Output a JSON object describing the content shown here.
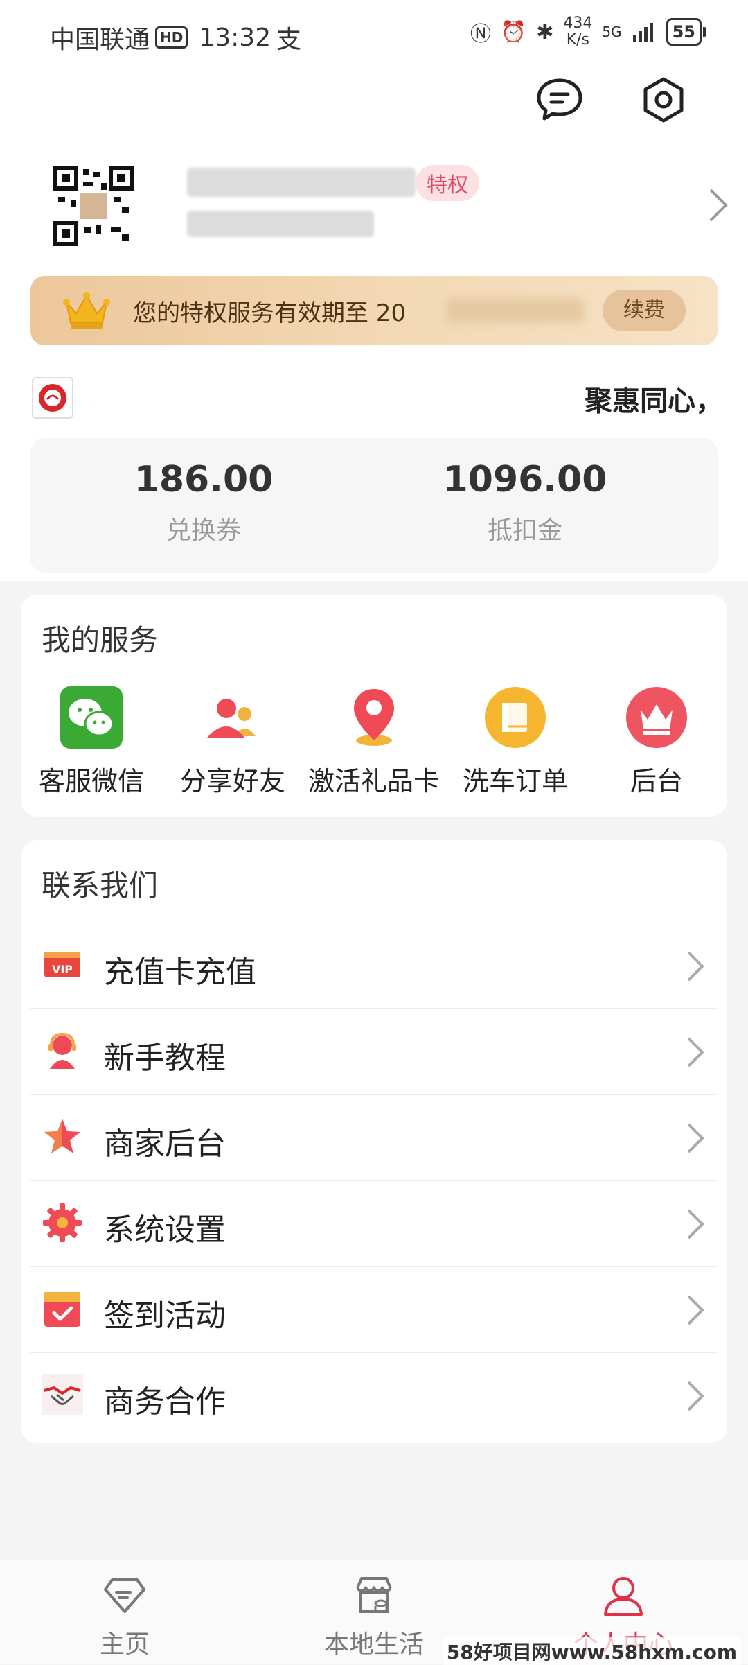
{
  "status_bar": {
    "carrier": "中国联通",
    "hd": "HD",
    "time": "13:32",
    "extra": "支",
    "speed_value": "434",
    "speed_unit": "K/s",
    "network": "5G",
    "battery": "55"
  },
  "profile": {
    "vip_tag": "特权"
  },
  "privilege": {
    "text": "您的特权服务有效期至 20",
    "renew_label": "续费"
  },
  "slogan": "聚惠同心，",
  "balance": [
    {
      "value": "186.00",
      "label": "兑换券"
    },
    {
      "value": "1096.00",
      "label": "抵扣金"
    }
  ],
  "services": {
    "title": "我的服务",
    "items": [
      {
        "label": "客服微信",
        "icon": "wechat-icon"
      },
      {
        "label": "分享好友",
        "icon": "users-icon"
      },
      {
        "label": "激活礼品卡",
        "icon": "location-pin-icon"
      },
      {
        "label": "洗车订单",
        "icon": "book-icon"
      },
      {
        "label": "后台",
        "icon": "crown-icon"
      }
    ]
  },
  "contact": {
    "title": "联系我们",
    "items": [
      {
        "label": "充值卡充值",
        "icon": "vip-card-icon"
      },
      {
        "label": "新手教程",
        "icon": "support-agent-icon"
      },
      {
        "label": "商家后台",
        "icon": "star-icon"
      },
      {
        "label": "系统设置",
        "icon": "gear-icon"
      },
      {
        "label": "签到活动",
        "icon": "checkin-icon"
      },
      {
        "label": "商务合作",
        "icon": "handshake-icon"
      }
    ]
  },
  "tabs": [
    {
      "label": "主页",
      "icon": "diamond-home-icon"
    },
    {
      "label": "本地生活",
      "icon": "shop-icon"
    },
    {
      "label": "个人中心",
      "icon": "person-icon",
      "active": true
    }
  ],
  "watermark": "58好项目网www.58hxm.com",
  "colors": {
    "accent": "#e0314b",
    "gold": "#f0cfa6"
  }
}
